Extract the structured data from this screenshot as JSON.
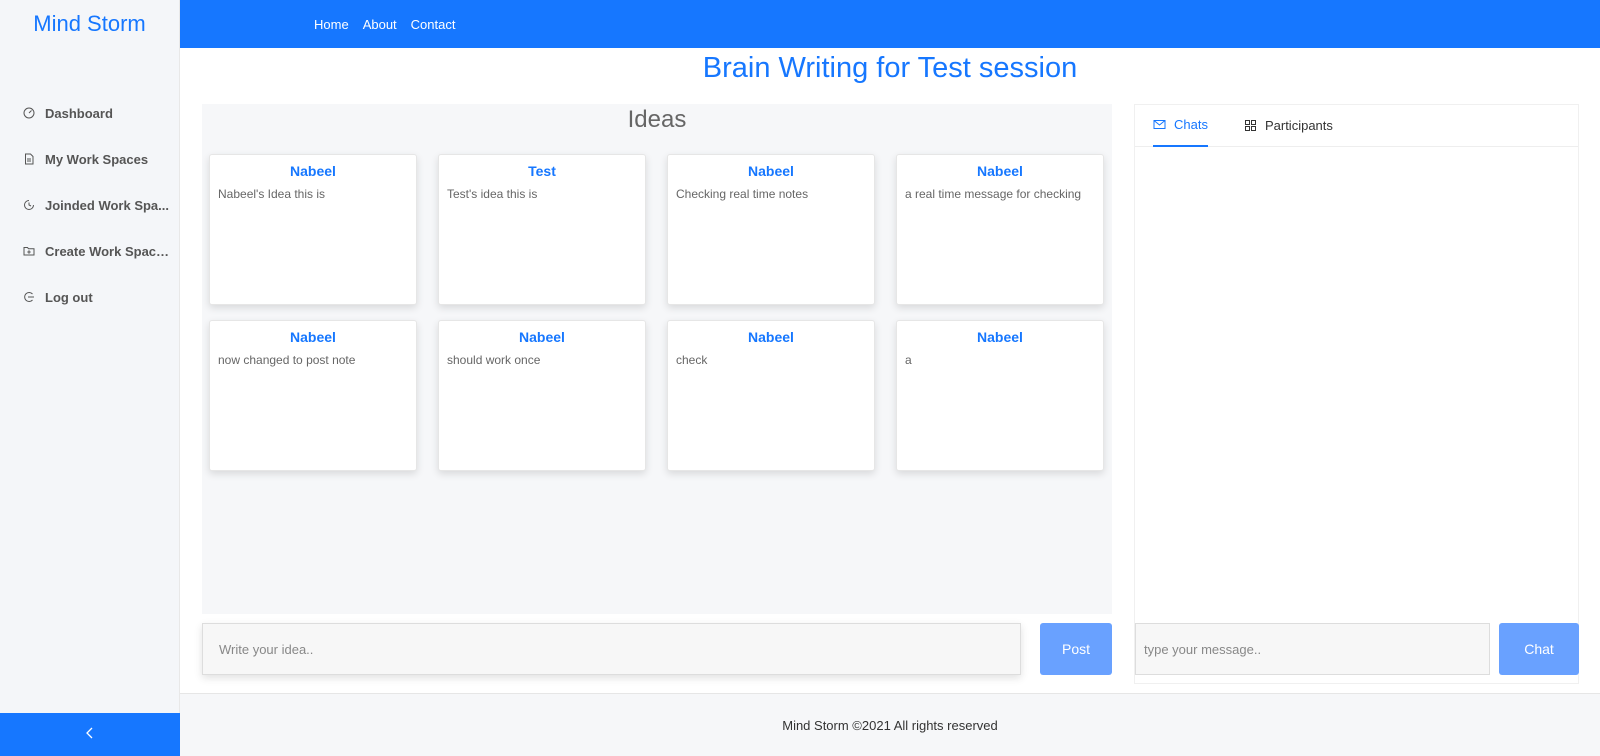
{
  "app": {
    "logo": "Mind Storm"
  },
  "nav": {
    "items": [
      "Home",
      "About",
      "Contact"
    ]
  },
  "sidebar": {
    "items": [
      {
        "label": "Dashboard",
        "icon": "dashboard-icon"
      },
      {
        "label": "My Work Spaces",
        "icon": "file-icon"
      },
      {
        "label": "Joinded Work Spa...",
        "icon": "history-icon"
      },
      {
        "label": "Create Work Spaces",
        "icon": "folder-add-icon"
      },
      {
        "label": "Log out",
        "icon": "logout-icon"
      }
    ],
    "collapse_icon": "chevron-left-icon"
  },
  "page": {
    "title": "Brain Writing for Test session"
  },
  "ideas": {
    "title": "Ideas",
    "notes": [
      {
        "author": "Nabeel",
        "text": "Nabeel's Idea this is"
      },
      {
        "author": "Test",
        "text": "Test's idea this is"
      },
      {
        "author": "Nabeel",
        "text": "Checking real time notes"
      },
      {
        "author": "Nabeel",
        "text": "a real time message for checking"
      },
      {
        "author": "Nabeel",
        "text": "now changed to post note"
      },
      {
        "author": "Nabeel",
        "text": "should work once"
      },
      {
        "author": "Nabeel",
        "text": "check"
      },
      {
        "author": "Nabeel",
        "text": "a"
      }
    ],
    "input_placeholder": "Write your idea..",
    "post_label": "Post"
  },
  "chat": {
    "tabs": [
      {
        "label": "Chats",
        "icon": "mail-icon",
        "active": true
      },
      {
        "label": "Participants",
        "icon": "appstore-icon",
        "active": false
      }
    ],
    "input_placeholder": "type your message..",
    "button_label": "Chat"
  },
  "footer": {
    "text": "Mind Storm ©2021 All rights reserved"
  },
  "colors": {
    "primary": "#1677ff",
    "button": "#69a1ff",
    "panel_bg": "#f6f7f9"
  }
}
